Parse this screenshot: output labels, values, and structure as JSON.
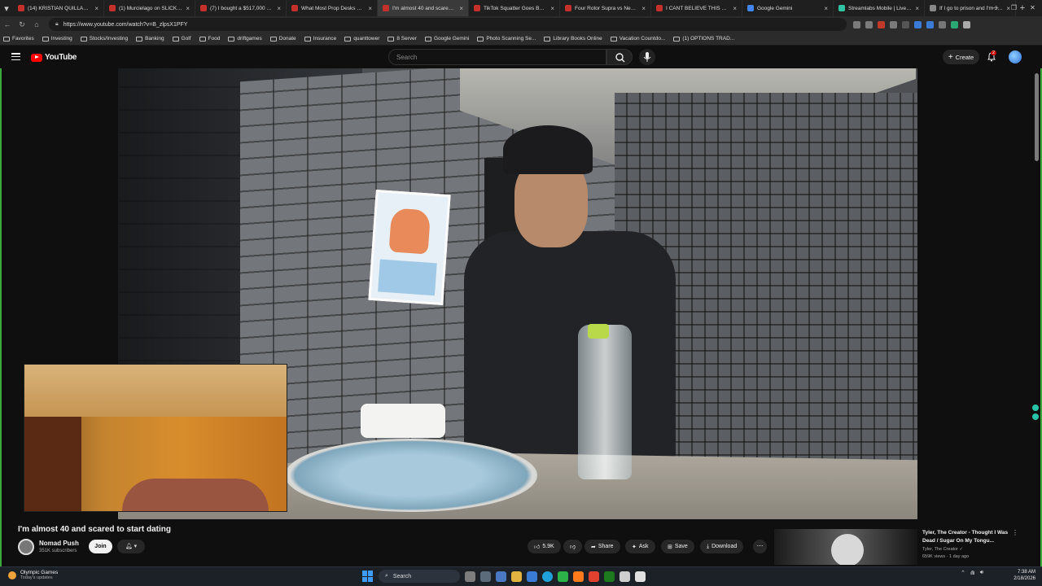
{
  "browser": {
    "tabs": [
      {
        "title": "(14) KRISTIAN QUILLAMAGO",
        "color": "#c4302b"
      },
      {
        "title": "(1) Murcielago on SLICKS La",
        "color": "#c4302b"
      },
      {
        "title": "(7) I bought a $517,000 purp",
        "color": "#c4302b"
      },
      {
        "title": "What Most Prop Desks Don't",
        "color": "#c4302b"
      },
      {
        "title": "I'm almost 40 and scared to",
        "color": "#c4302b"
      },
      {
        "title": "TikTok Squatter Goes BACK",
        "color": "#c4302b"
      },
      {
        "title": "Four Rotor Supra vs New Ze",
        "color": "#c4302b"
      },
      {
        "title": "I CANT BELIEVE THIS HAPPE",
        "color": "#c4302b"
      },
      {
        "title": "Google Gemini",
        "color": "#4285f4"
      },
      {
        "title": "Streamlabs Mobile | Live Str",
        "color": "#31c3a2"
      },
      {
        "title": "If I go to prison and I'm 33 a",
        "color": "#888888"
      }
    ],
    "active_tab_index": 4,
    "url": "https://www.youtube.com/watch?v=B_zlpsX1PFY",
    "bookmarks": [
      "Favorites",
      "Investing",
      "Stocks/Investing",
      "Banking",
      "Golf",
      "Food",
      "driftgames",
      "Donate",
      "Insurance",
      "quanttower",
      "8 Server",
      "Google Gemini",
      "Photo Scanning Se...",
      "Library Books Online",
      "Vacation Countdo...",
      "(1) OPTIONS TRAD..."
    ]
  },
  "youtube": {
    "logo": "YouTube",
    "search_placeholder": "Search",
    "create_label": "Create",
    "notification_count": "2"
  },
  "video": {
    "title": "I'm almost 40 and scared to start dating",
    "channel": "Nomad Push",
    "subscribers": "351K subscribers",
    "join_label": "Join",
    "likes": "5.9K",
    "share_label": "Share",
    "ask_label": "Ask",
    "save_label": "Save",
    "download_label": "Download"
  },
  "recommendation": {
    "title": "Tyler, The Creator - Thought I Was Dead / Sugar On My Tongu...",
    "channel": "Tyler, The Creator",
    "meta": "659K views · 1 day ago"
  },
  "taskbar": {
    "weather_title": "Olympic Games",
    "weather_sub": "Today's updates",
    "search_label": "Search",
    "time": "7:38 AM",
    "date": "2/18/2026"
  }
}
